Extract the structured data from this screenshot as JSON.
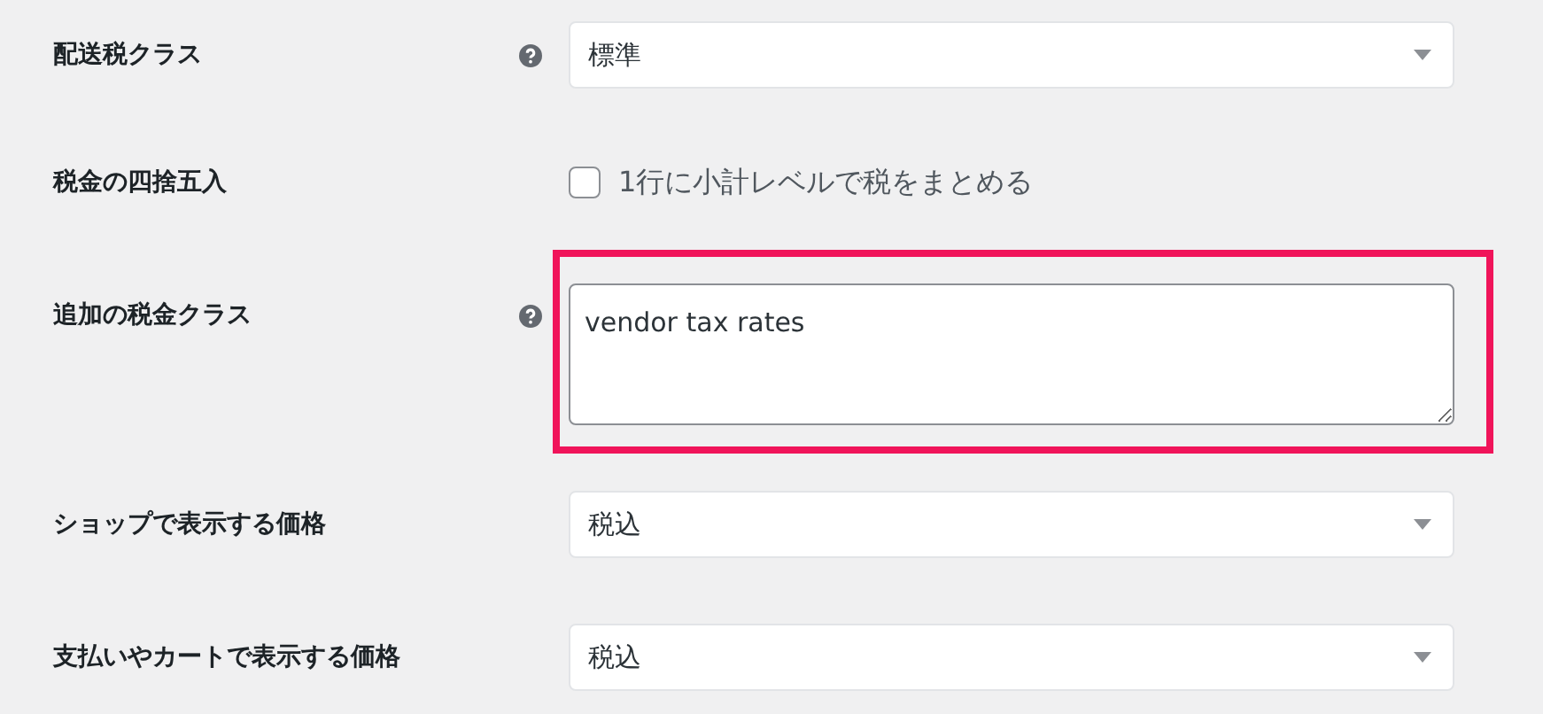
{
  "settings": [
    {
      "kind": "select",
      "label": "配送税クラス",
      "help": true,
      "value": "標準",
      "highlighted": false
    },
    {
      "kind": "checkbox",
      "label": "税金の四捨五入",
      "help": false,
      "checked": false,
      "option": "1行に小計レベルで税をまとめる",
      "highlighted": false
    },
    {
      "kind": "textarea",
      "label": "追加の税金クラス",
      "help": true,
      "value": "vendor tax rates",
      "highlighted": true
    },
    {
      "kind": "select",
      "label": "ショップで表示する価格",
      "help": false,
      "value": "税込",
      "highlighted": false
    },
    {
      "kind": "select",
      "label": "支払いやカートで表示する価格",
      "help": false,
      "value": "税込",
      "highlighted": false
    }
  ]
}
